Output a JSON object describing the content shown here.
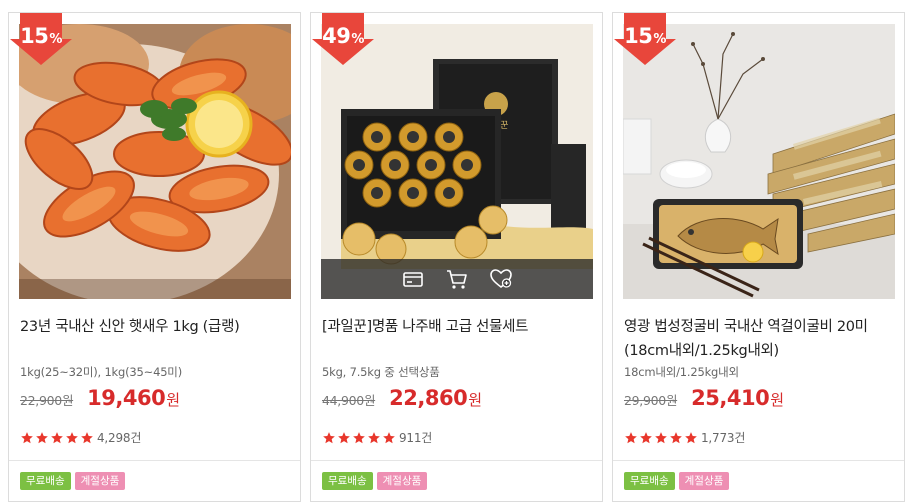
{
  "colors": {
    "badge": "#e8463b",
    "sale_price": "#d72b2b",
    "tag_free": "#7cc043",
    "tag_season": "#ee8fb3",
    "star": "#e8372c"
  },
  "products": [
    {
      "discount": "15",
      "discount_unit": "%",
      "title": "23년 국내산 신안 햇새우 1kg (급랭)",
      "option": "1kg(25~32미), 1kg(35~45미)",
      "original_price": "22,900원",
      "sale_price": "19,460",
      "currency": "원",
      "rating": 5,
      "reviews": "4,298건",
      "tags": [
        "무료배송",
        "계절상품"
      ]
    },
    {
      "discount": "49",
      "discount_unit": "%",
      "title": "[과일꾼]명품 나주배 고급 선물세트",
      "option": "5kg, 7.5kg 중 선택상품",
      "original_price": "44,900원",
      "sale_price": "22,860",
      "currency": "원",
      "rating": 5,
      "reviews": "911건",
      "tags": [
        "무료배송",
        "계절상품"
      ],
      "box_label": "과일꾼",
      "hover_actions": [
        "card-icon",
        "cart-icon",
        "wishlist-heart-icon"
      ]
    },
    {
      "discount": "15",
      "discount_unit": "%",
      "title": "영광 법성정굴비 국내산 역걸이굴비 20미(18cm내외/1.25kg내외)",
      "option": "18cm내외/1.25kg내외",
      "original_price": "29,900원",
      "sale_price": "25,410",
      "currency": "원",
      "rating": 5,
      "reviews": "1,773건",
      "tags": [
        "무료배송",
        "계절상품"
      ]
    }
  ]
}
